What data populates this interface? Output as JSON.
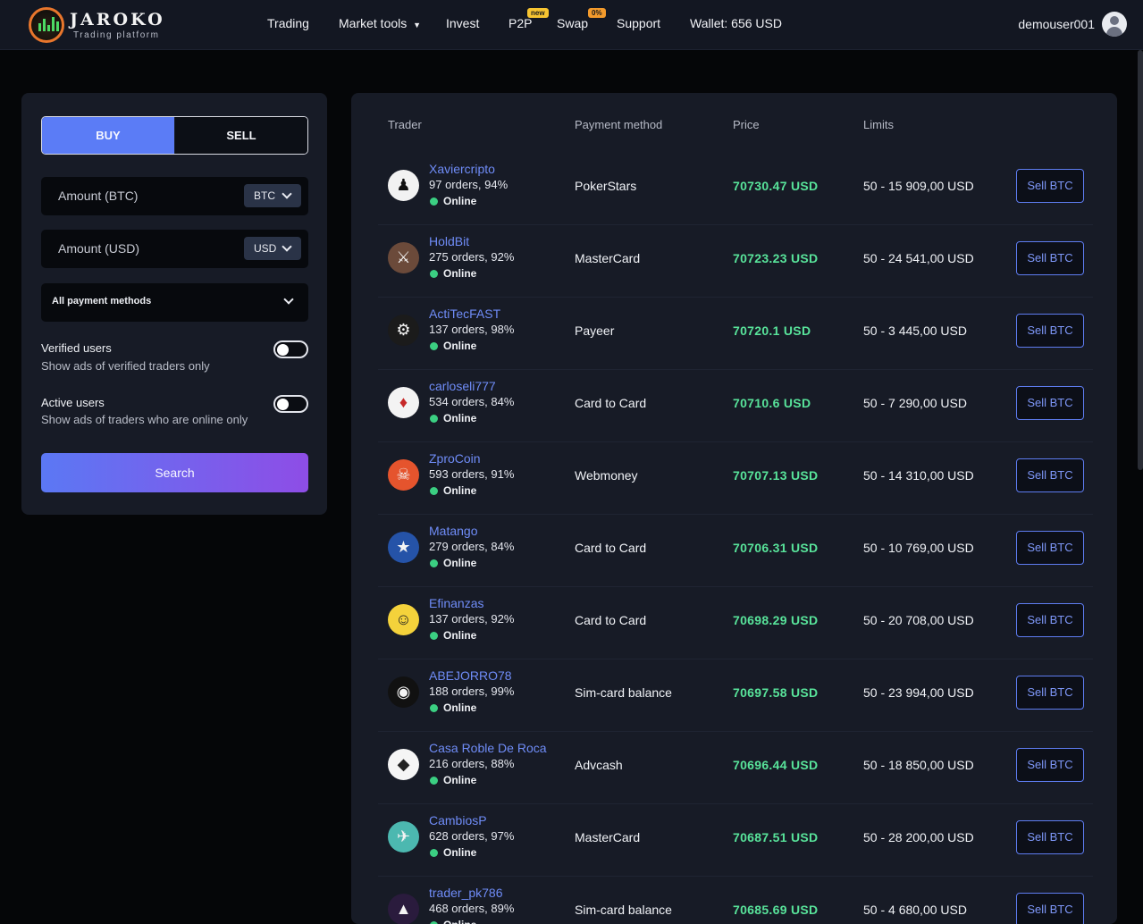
{
  "header": {
    "logo_title": "JAROKO",
    "logo_subtitle": "Trading platform",
    "nav": {
      "trading": "Trading",
      "market_tools": "Market tools",
      "invest": "Invest",
      "p2p": "P2P",
      "p2p_badge": "new",
      "swap": "Swap",
      "swap_badge": "0%",
      "support": "Support",
      "wallet": "Wallet: 656 USD"
    },
    "username": "demouser001"
  },
  "filters": {
    "buy_label": "BUY",
    "sell_label": "SELL",
    "active_tab": "BUY",
    "amount_btc_label": "Amount (BTC)",
    "btc_currency": "BTC",
    "amount_usd_label": "Amount (USD)",
    "usd_currency": "USD",
    "payment_methods": "All payment methods",
    "verified_title": "Verified users",
    "verified_desc": "Show ads of verified traders only",
    "verified_on": false,
    "active_title": "Active users",
    "active_desc": "Show ads of traders who are online only",
    "active_on": false,
    "search_label": "Search"
  },
  "table": {
    "headers": {
      "trader": "Trader",
      "payment": "Payment method",
      "price": "Price",
      "limits": "Limits"
    },
    "rows": [
      {
        "name": "Xaviercripto",
        "orders": "97 orders, 94%",
        "status": "Online",
        "payment": "PokerStars",
        "price": "70730.47 USD",
        "limits": "50 - 15 909,00 USD",
        "action": "Sell BTC",
        "avatar_icon": "dark-figure-icon",
        "avatar_bg": "#f2f2f2"
      },
      {
        "name": "HoldBit",
        "orders": "275 orders, 92%",
        "status": "Online",
        "payment": "MasterCard",
        "price": "70723.23 USD",
        "limits": "50 - 24 541,00 USD",
        "action": "Sell BTC",
        "avatar_icon": "warrior-icon",
        "avatar_bg": "#6b4a3a"
      },
      {
        "name": "ActiTecFAST",
        "orders": "137 orders, 98%",
        "status": "Online",
        "payment": "Payeer",
        "price": "70720.1 USD",
        "limits": "50 - 3 445,00 USD",
        "action": "Sell BTC",
        "avatar_icon": "robot-icon",
        "avatar_bg": "#1b1b1b"
      },
      {
        "name": "carloseli777",
        "orders": "534 orders, 84%",
        "status": "Online",
        "payment": "Card to Card",
        "price": "70710.6 USD",
        "limits": "50 - 7 290,00 USD",
        "action": "Sell BTC",
        "avatar_icon": "masked-hero-icon",
        "avatar_bg": "#f3f3f3"
      },
      {
        "name": "ZproCoin",
        "orders": "593 orders, 91%",
        "status": "Online",
        "payment": "Webmoney",
        "price": "70707.13 USD",
        "limits": "50 - 14 310,00 USD",
        "action": "Sell BTC",
        "avatar_icon": "skull-icon",
        "avatar_bg": "#e5542d"
      },
      {
        "name": "Matango",
        "orders": "279 orders, 84%",
        "status": "Online",
        "payment": "Card to Card",
        "price": "70706.31 USD",
        "limits": "50 - 10 769,00 USD",
        "action": "Sell BTC",
        "avatar_icon": "trooper-icon",
        "avatar_bg": "#2553a8"
      },
      {
        "name": "Efinanzas",
        "orders": "137 orders, 92%",
        "status": "Online",
        "payment": "Card to Card",
        "price": "70698.29 USD",
        "limits": "50 - 20 708,00 USD",
        "action": "Sell BTC",
        "avatar_icon": "portrait-icon",
        "avatar_bg": "#f4d23b"
      },
      {
        "name": "ABEJORRO78",
        "orders": "188 orders, 99%",
        "status": "Online",
        "payment": "Sim-card balance",
        "price": "70697.58 USD",
        "limits": "50 - 23 994,00 USD",
        "action": "Sell BTC",
        "avatar_icon": "helmet-icon",
        "avatar_bg": "#111111"
      },
      {
        "name": "Casa Roble De Roca",
        "orders": "216 orders, 88%",
        "status": "Online",
        "payment": "Advcash",
        "price": "70696.44 USD",
        "limits": "50 - 18 850,00 USD",
        "action": "Sell BTC",
        "avatar_icon": "ethereum-icon",
        "avatar_bg": "#f5f5f5"
      },
      {
        "name": "CambiosP",
        "orders": "628 orders, 97%",
        "status": "Online",
        "payment": "MasterCard",
        "price": "70687.51 USD",
        "limits": "50 - 28 200,00 USD",
        "action": "Sell BTC",
        "avatar_icon": "plane-icon",
        "avatar_bg": "#4cb8b0"
      },
      {
        "name": "trader_pk786",
        "orders": "468 orders, 89%",
        "status": "Online",
        "payment": "Sim-card balance",
        "price": "70685.69 USD",
        "limits": "50 - 4 680,00 USD",
        "action": "Sell BTC",
        "avatar_icon": "hood-icon",
        "avatar_bg": "#2a1b3d"
      }
    ]
  }
}
